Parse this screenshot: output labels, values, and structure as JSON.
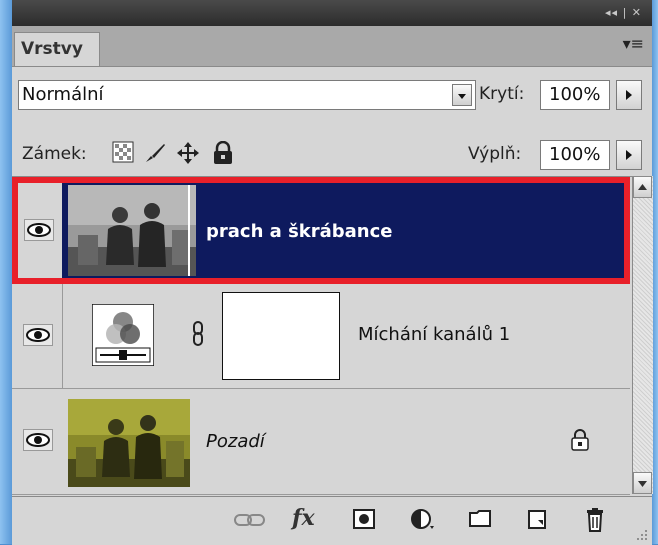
{
  "panel": {
    "tab_label": "Vrstvy",
    "title_controls": "◂◂ | ✕",
    "menu_icon": "panel-menu-icon"
  },
  "blend": {
    "mode": "Normální",
    "opacity_label": "Krytí:",
    "opacity_value": "100%",
    "fill_label": "Výplň:",
    "fill_value": "100%"
  },
  "lock": {
    "label": "Zámek:",
    "icons": [
      "lock-transparency-icon",
      "lock-paint-icon",
      "lock-move-icon",
      "lock-all-icon"
    ]
  },
  "layers": [
    {
      "name": "prach a škrábance",
      "visible": true,
      "selected": true,
      "type": "smart-photo"
    },
    {
      "name": "Míchání kanálů 1",
      "visible": true,
      "selected": false,
      "type": "adjustment"
    },
    {
      "name": "Pozadí",
      "visible": true,
      "selected": false,
      "type": "background",
      "locked": true
    }
  ],
  "colors": {
    "selected_bg": "#0e1a5e",
    "highlight_outline": "#e8202a",
    "panel_bg": "#d6d6d6"
  },
  "bottom_toolbar": {
    "fx_label": "fx",
    "icons": [
      "link-layers-icon",
      "fx-icon",
      "add-mask-icon",
      "adjustment-layer-icon",
      "new-group-icon",
      "new-layer-icon",
      "trash-icon"
    ]
  }
}
